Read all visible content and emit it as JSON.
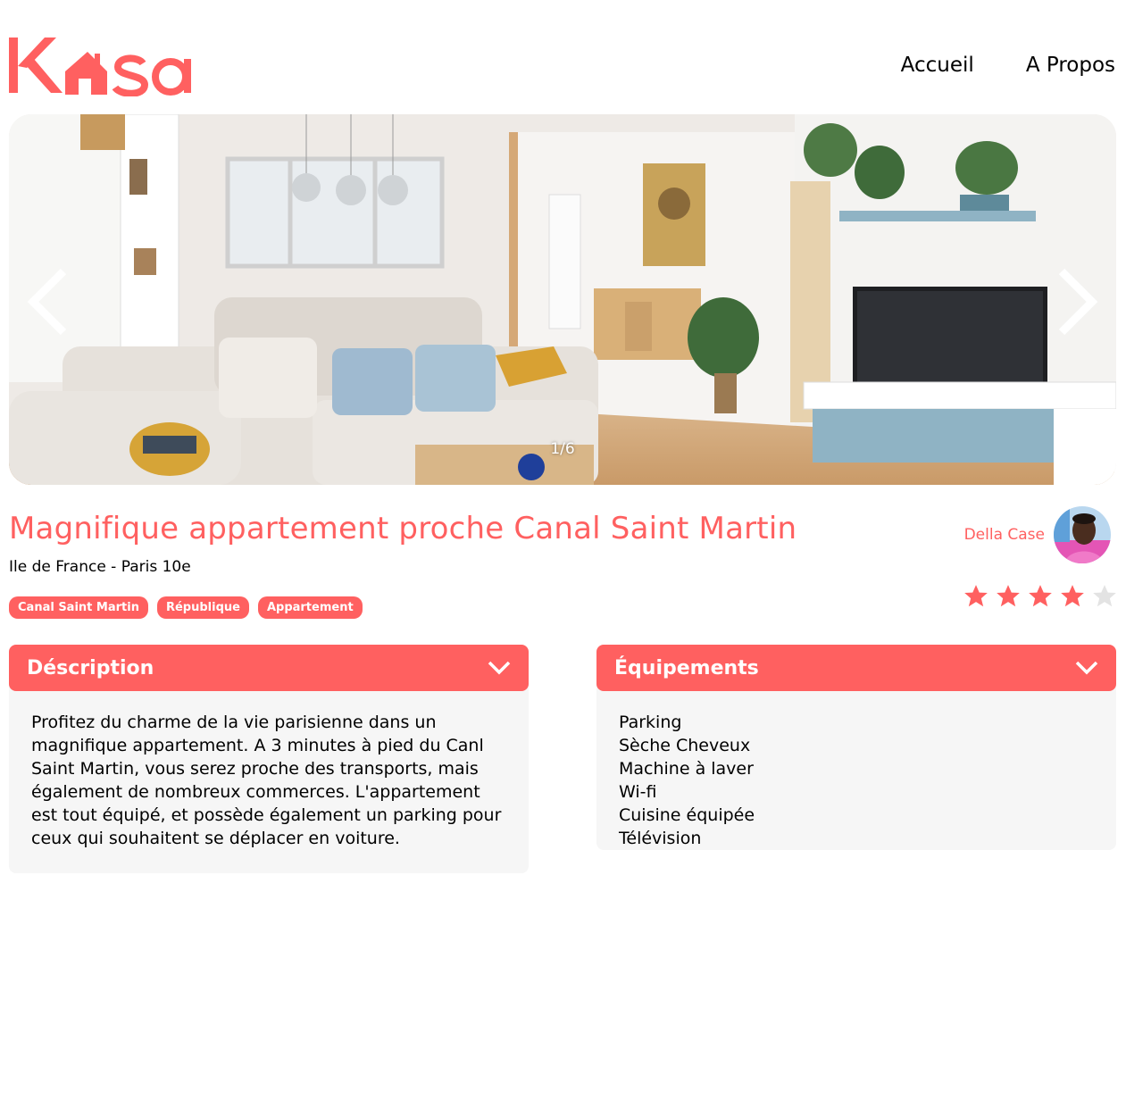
{
  "brand": {
    "name": "Kasa",
    "color": "#FF6060"
  },
  "nav": {
    "home": "Accueil",
    "about": "A Propos"
  },
  "carousel": {
    "counter": "1/6",
    "prev_icon": "chevron-left-icon",
    "next_icon": "chevron-right-icon"
  },
  "listing": {
    "title": "Magnifique appartement proche Canal Saint Martin",
    "location": "Ile de France - Paris 10e",
    "tags": [
      "Canal Saint Martin",
      "République",
      "Appartement"
    ],
    "host": {
      "name": "Della Case"
    },
    "rating": {
      "value": 4,
      "max": 5,
      "active_color": "#FF6060",
      "inactive_color": "#E3E3E3"
    }
  },
  "description": {
    "title": "Déscription",
    "text": "Profitez du charme de la vie parisienne dans un magnifique appartement. A 3 minutes à pied du Canl Saint Martin, vous serez proche des transports, mais également de nombreux commerces. L'appartement est tout équipé, et possède également un parking pour ceux qui souhaitent se déplacer en voiture."
  },
  "equipments": {
    "title": "Équipements",
    "items": [
      "Parking",
      "Sèche Cheveux",
      "Machine à laver",
      "Wi-fi",
      "Cuisine équipée",
      "Télévision"
    ]
  }
}
